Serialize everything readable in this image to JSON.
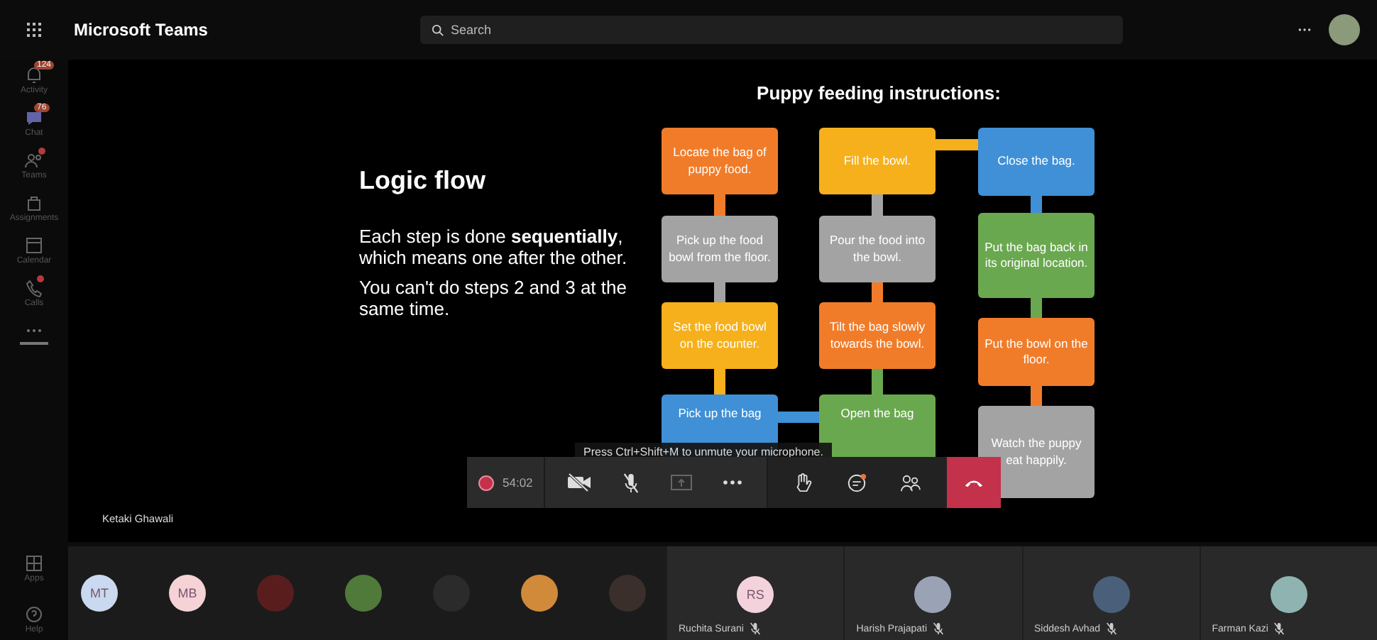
{
  "app": {
    "title": "Microsoft Teams"
  },
  "search": {
    "placeholder": "Search"
  },
  "rail": [
    {
      "kind": "activity",
      "label": "Activity",
      "badge": "124",
      "dot": false
    },
    {
      "kind": "chat",
      "label": "Chat",
      "badge": "76",
      "dot": false
    },
    {
      "kind": "teams",
      "label": "Teams",
      "dot": true
    },
    {
      "kind": "assignments",
      "label": "Assignments",
      "dot": false
    },
    {
      "kind": "calendar",
      "label": "Calendar",
      "dot": false
    },
    {
      "kind": "calls",
      "label": "Calls",
      "dot": true
    }
  ],
  "rail_bottom": [
    {
      "kind": "apps",
      "label": "Apps"
    },
    {
      "kind": "help",
      "label": "Help"
    }
  ],
  "slide": {
    "heading": "Logic flow",
    "paragraphs": [
      "Each step is done **sequentially**, which means one after the other.",
      "You can't do steps 2 and 3 at the same time."
    ],
    "flow_title": "Puppy feeding instructions:",
    "columns": [
      {
        "steps": [
          {
            "text": "Locate the bag of puppy food.",
            "color": "#f07c2a"
          },
          {
            "text": "Pick up the food bowl from the floor.",
            "color": "#a3a3a3"
          },
          {
            "text": "Set the food bowl on the counter.",
            "color": "#f5b01c"
          },
          {
            "text": "Pick up the bag",
            "color": "#3f90d6"
          }
        ]
      },
      {
        "steps": [
          {
            "text": "Fill the bowl.",
            "color": "#f5b01c"
          },
          {
            "text": "Pour the food into the bowl.",
            "color": "#a3a3a3"
          },
          {
            "text": "Tilt the bag slowly towards the bowl.",
            "color": "#f07c2a"
          },
          {
            "text": "Open the bag",
            "color": "#6aa84f"
          }
        ]
      },
      {
        "steps": [
          {
            "text": "Close the bag.",
            "color": "#3f90d6"
          },
          {
            "text": "Put the bag back in its original location.",
            "color": "#6aa84f"
          },
          {
            "text": "Put the bowl on the floor.",
            "color": "#f07c2a"
          },
          {
            "text": "Watch the puppy eat happily.",
            "color": "#a3a3a3"
          }
        ]
      }
    ]
  },
  "presenter": "Ketaki Ghawali",
  "call": {
    "hint": "Press Ctrl+Shift+M to unmute your microphone.",
    "recording": true,
    "timer": "54:02",
    "camera_on": false,
    "mic_on": false,
    "share_disabled": true
  },
  "avatars": [
    {
      "kind": "initials",
      "initials": "MT",
      "color": "#c9d9ef"
    },
    {
      "kind": "initials",
      "initials": "MB",
      "color": "#f4d2d6"
    },
    {
      "kind": "photo",
      "color": "#5a1d1d"
    },
    {
      "kind": "photo",
      "color": "#4f7a3a"
    },
    {
      "kind": "photo",
      "color": "#2b2b2b"
    },
    {
      "kind": "photo",
      "color": "#d08a3a"
    },
    {
      "kind": "photo",
      "color": "#3a2f2a"
    }
  ],
  "tiles": [
    {
      "kind": "initials",
      "initials": "RS",
      "color": "#f4d2dc",
      "name": "Ruchita Surani",
      "muted": true
    },
    {
      "kind": "photo",
      "color": "#9aa3b5",
      "name": "Harish Prajapati",
      "muted": true
    },
    {
      "kind": "photo",
      "color": "#4a5f7a",
      "name": "Siddesh Avhad",
      "muted": true
    },
    {
      "kind": "photo",
      "color": "#8fb3b0",
      "name": "Farman Kazi",
      "muted": true
    }
  ]
}
